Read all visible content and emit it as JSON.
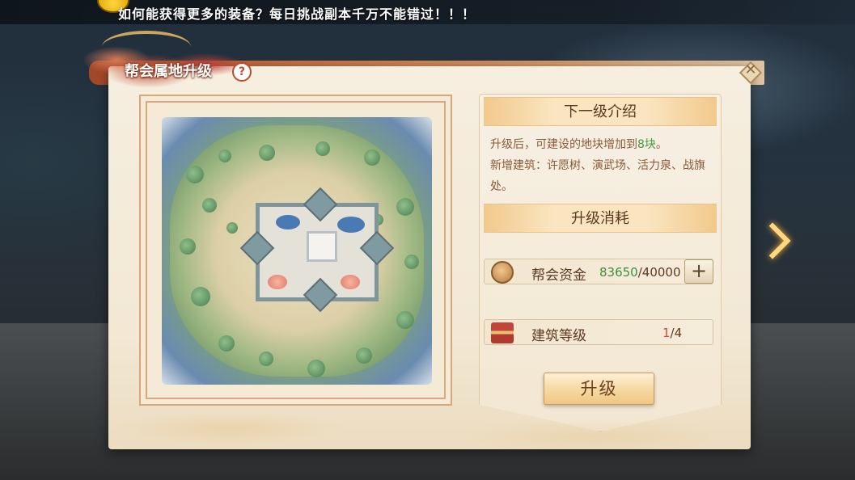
{
  "banner": {
    "text": "如何能获得更多的装备？每日挑战副本千万不能错过！！！"
  },
  "panel": {
    "title": "帮会属地升级",
    "help_label": "?",
    "close_label": "✕"
  },
  "next_level": {
    "header": "下一级介绍",
    "desc_prefix": "升级后，可建设的地块增加到",
    "desc_highlight": "8块",
    "desc_suffix": "。",
    "desc_line2": "新增建筑：许愿树、演武场、活力泉、战旗处。"
  },
  "cost": {
    "header": "升级消耗",
    "funds": {
      "label": "帮会资金",
      "current": "83650",
      "required": "/40000",
      "plus_label": "+"
    },
    "building_level": {
      "label": "建筑等级",
      "current": "1",
      "required": "/4"
    }
  },
  "upgrade_button": {
    "label": "升级"
  },
  "colors": {
    "accent_green": "#3f8b3f",
    "accent_red": "#d24b3b",
    "text_brown": "#5a3a22"
  }
}
